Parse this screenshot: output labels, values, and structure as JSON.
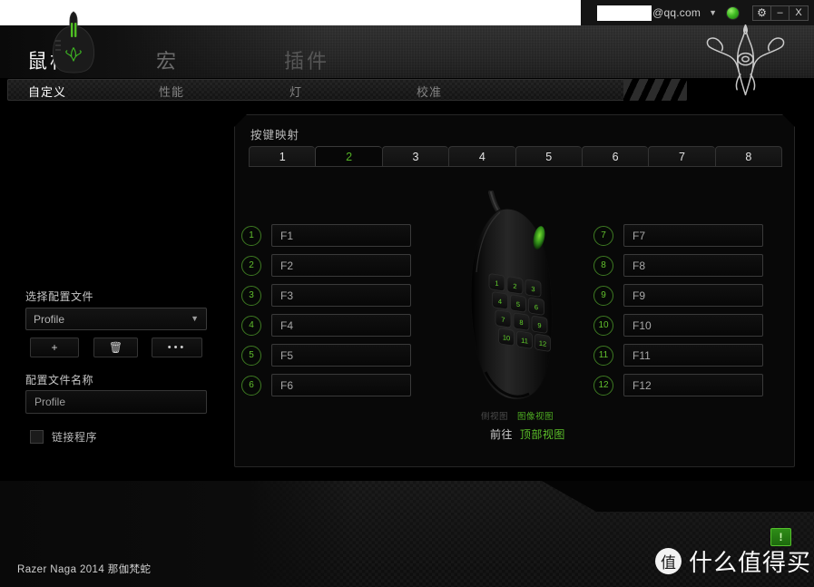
{
  "titlebar": {
    "email": "@qq.com",
    "caret_icon": "chevron-down-icon",
    "status_icon": "online-status-indicator",
    "gear_label": "⚙",
    "minimize_label": "–",
    "close_label": "X"
  },
  "mainnav": {
    "items": [
      {
        "label": "鼠标",
        "active": true
      },
      {
        "label": "宏",
        "active": false
      },
      {
        "label": "插件",
        "active": false
      }
    ]
  },
  "subnav": {
    "items": [
      {
        "label": "自定义",
        "active": true
      },
      {
        "label": "性能",
        "active": false
      },
      {
        "label": "灯",
        "active": false
      },
      {
        "label": "校准",
        "active": false
      }
    ]
  },
  "sidebar": {
    "profile_select_label": "选择配置文件",
    "profile_select_value": "Profile",
    "profile_select_caret": "▼",
    "buttons": [
      {
        "name": "add-profile-button",
        "glyph": "+"
      },
      {
        "name": "delete-profile-button",
        "glyph": "Ὕ1"
      },
      {
        "name": "more-options-button",
        "glyph": "• • •"
      }
    ],
    "profile_name_label": "配置文件名称",
    "profile_name_value": "Profile",
    "link_program_label": "链接程序",
    "link_program_checked": false
  },
  "panel": {
    "title": "按键映射",
    "tabs": [
      {
        "label": "1",
        "active": false
      },
      {
        "label": "2",
        "active": true
      },
      {
        "label": "3",
        "active": false
      },
      {
        "label": "4",
        "active": false
      },
      {
        "label": "5",
        "active": false
      },
      {
        "label": "6",
        "active": false
      },
      {
        "label": "7",
        "active": false
      },
      {
        "label": "8",
        "active": false
      }
    ],
    "keys_left": [
      {
        "num": "1",
        "value": "F1"
      },
      {
        "num": "2",
        "value": "F2"
      },
      {
        "num": "3",
        "value": "F3"
      },
      {
        "num": "4",
        "value": "F4"
      },
      {
        "num": "5",
        "value": "F5"
      },
      {
        "num": "6",
        "value": "F6"
      }
    ],
    "keys_right": [
      {
        "num": "7",
        "value": "F7"
      },
      {
        "num": "8",
        "value": "F8"
      },
      {
        "num": "9",
        "value": "F9"
      },
      {
        "num": "10",
        "value": "F10"
      },
      {
        "num": "11",
        "value": "F11"
      },
      {
        "num": "12",
        "value": "F12"
      }
    ],
    "view_side_label": "侧视图",
    "view_image_label": "图像视图",
    "goto_prefix": "前往",
    "goto_link": "顶部视图",
    "mouse_buttons": [
      "1",
      "2",
      "3",
      "4",
      "5",
      "6",
      "7",
      "8",
      "9",
      "10",
      "11",
      "12"
    ]
  },
  "devicebar": {
    "device_name": "Razer Naga 2014 那伽梵蛇",
    "alert_label": "!"
  },
  "watermark": {
    "badge": "值",
    "text": "什么值得买"
  },
  "colors": {
    "accent_green": "#53b125",
    "panel_bg": "#080808",
    "app_bg": "#0a0a0a"
  }
}
